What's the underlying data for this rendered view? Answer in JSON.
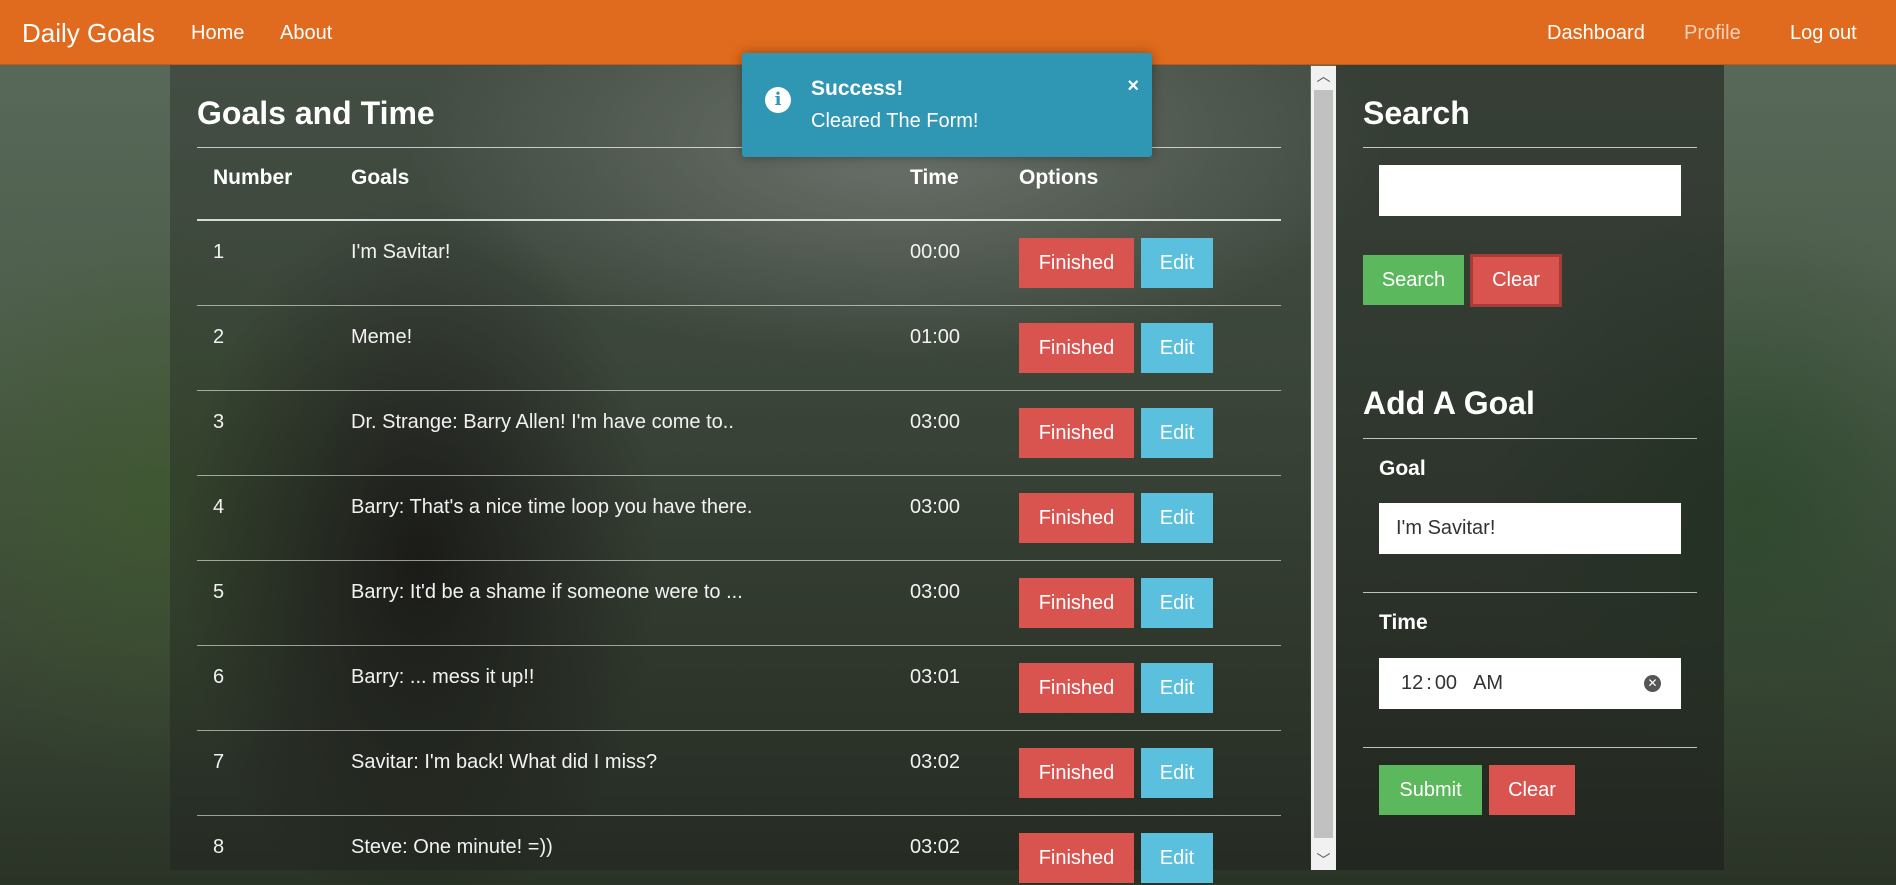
{
  "navbar": {
    "brand": "Daily Goals",
    "left_links": [
      "Home",
      "About"
    ],
    "right_links": [
      "Dashboard",
      "Profile",
      "Log out"
    ]
  },
  "goals": {
    "title": "Goals and Time",
    "headers": [
      "Number",
      "Goals",
      "Time",
      "Options"
    ],
    "finished_label": "Finished",
    "edit_label": "Edit",
    "rows": [
      {
        "number": "1",
        "goal": "I'm Savitar!",
        "time": "00:00"
      },
      {
        "number": "2",
        "goal": "Meme!",
        "time": "01:00"
      },
      {
        "number": "3",
        "goal": "Dr. Strange: Barry Allen! I'm have come to..",
        "time": "03:00"
      },
      {
        "number": "4",
        "goal": "Barry: That's a nice time loop you have there.",
        "time": "03:00"
      },
      {
        "number": "5",
        "goal": "Barry: It'd be a shame if someone were to ...",
        "time": "03:00"
      },
      {
        "number": "6",
        "goal": "Barry: ... mess it up!!",
        "time": "03:01"
      },
      {
        "number": "7",
        "goal": "Savitar: I'm back! What did I miss?",
        "time": "03:02"
      },
      {
        "number": "8",
        "goal": "Steve: One minute! =))",
        "time": "03:02"
      }
    ]
  },
  "search": {
    "title": "Search",
    "value": "",
    "search_label": "Search",
    "clear_label": "Clear"
  },
  "add_goal": {
    "title": "Add A Goal",
    "goal_label": "Goal",
    "goal_value": "I'm Savitar!",
    "time_label": "Time",
    "time_hour": "12",
    "time_sep": ":",
    "time_minute": "00",
    "time_ampm": "AM",
    "submit_label": "Submit",
    "clear_label": "Clear"
  },
  "toast": {
    "title": "Success!",
    "message": "Cleared The Form!",
    "icon": "info-icon",
    "close": "×"
  },
  "colors": {
    "navbar": "#e06a1d",
    "danger": "#d9534f",
    "info": "#5bc0de",
    "success": "#5cb85c",
    "toast": "#2f96b4"
  }
}
